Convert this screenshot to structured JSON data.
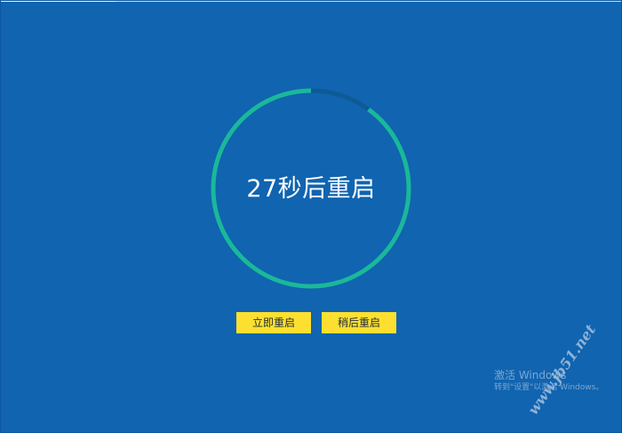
{
  "countdown": {
    "text": "27秒后重启",
    "seconds_remaining": 27,
    "progress_fraction": 0.9
  },
  "buttons": {
    "restart_now": "立即重启",
    "restart_later": "稍后重启"
  },
  "activation": {
    "title": "激活 Windows",
    "subtitle": "转到\"设置\"以激活 Windows。"
  },
  "watermark": {
    "text": "www.jb51.net"
  },
  "colors": {
    "background": "#1064b0",
    "ring_progress": "#1ab89a",
    "ring_track": "#0d5a96",
    "button_bg": "#fde02f",
    "button_text": "#1f2c3a",
    "countdown_text": "#ffffff"
  }
}
